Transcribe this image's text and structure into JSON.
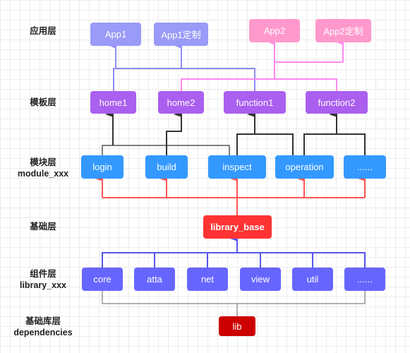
{
  "layers": {
    "app": "应用层",
    "template": "模板层",
    "module": [
      "模块层",
      "module_xxx"
    ],
    "base": "基础层",
    "component": [
      "组件层",
      "library_xxx"
    ],
    "dependencies": [
      "基础库层",
      "dependencies"
    ]
  },
  "apps": [
    {
      "label": "App1",
      "group": "app1"
    },
    {
      "label": "App1定制",
      "group": "app1"
    },
    {
      "label": "App2",
      "group": "app2"
    },
    {
      "label": "App2定制",
      "group": "app2"
    }
  ],
  "templates": [
    "home1",
    "home2",
    "function1",
    "function2"
  ],
  "modules": [
    "login",
    "build",
    "inspect",
    "operation",
    "......"
  ],
  "base": "library_base",
  "components": [
    "core",
    "atta",
    "net",
    "view",
    "util",
    "......"
  ],
  "lib": "lib",
  "colors": {
    "app1": "#9a9af8",
    "app2": "#ff99cc",
    "template": "#aa5fee",
    "module": "#3399ff",
    "base": "#ff3333",
    "component": "#6666ff",
    "lib": "#cc0000",
    "edge_app1": "#8c8cf5",
    "edge_app2": "#ff88ee",
    "edge_template": "#333333",
    "edge_module": "#ff5555",
    "edge_component": "#5555ee",
    "edge_lib": "#999999"
  },
  "edges": [
    {
      "from": "home1",
      "to": [
        "App1",
        "App1定制"
      ]
    },
    {
      "from": "function1",
      "to": [
        "App1",
        "App1定制"
      ]
    },
    {
      "from": "home2",
      "to": [
        "App2",
        "App2定制"
      ]
    },
    {
      "from": "function2",
      "to": [
        "App2",
        "App2定制"
      ]
    },
    {
      "from": "login",
      "to": [
        "home1"
      ]
    },
    {
      "from": "inspect",
      "to": [
        "home1",
        "function1"
      ]
    },
    {
      "from": "build",
      "to": [
        "home2"
      ]
    },
    {
      "from": "operation",
      "to": [
        "function1",
        "function2"
      ]
    },
    {
      "from": "......",
      "to": [
        "function2"
      ]
    },
    {
      "from": "library_base",
      "to": [
        "login",
        "build",
        "inspect",
        "operation",
        "......"
      ]
    },
    {
      "from": "components",
      "to": [
        "library_base"
      ]
    },
    {
      "from": "lib",
      "to": [
        "components"
      ]
    }
  ]
}
